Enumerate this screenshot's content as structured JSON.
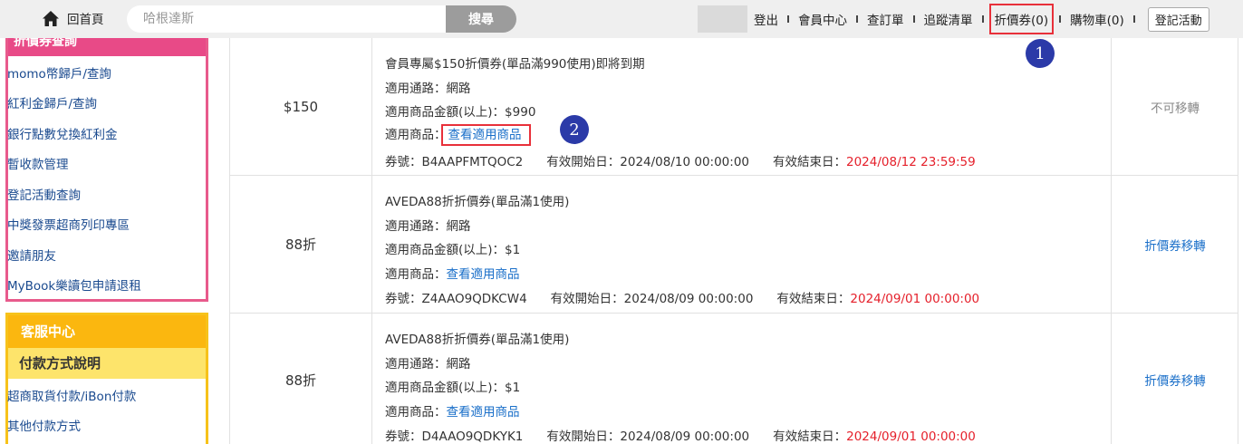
{
  "header": {
    "home_label": "回首頁",
    "search_placeholder": "哈根達斯",
    "search_button": "搜尋",
    "nav": {
      "logout": "登出",
      "member_center": "會員中心",
      "orders": "查訂單",
      "wishlist": "追蹤清單",
      "coupons": "折價券(0)",
      "cart": "購物車(0)",
      "event_register": "登記活動"
    }
  },
  "annotations": {
    "marker_1": "1",
    "marker_2": "2"
  },
  "sidebar": {
    "member_section": {
      "header": "折價券查詢",
      "items": [
        "momo幣歸戶/查詢",
        "紅利金歸戶/查詢",
        "銀行點數兌換紅利金",
        "暫收款管理",
        "登記活動查詢",
        "中獎發票超商列印專區",
        "邀請朋友",
        "MyBook樂讀包申請退租"
      ]
    },
    "service_section": {
      "header": "客服中心",
      "subheader": "付款方式說明",
      "items": [
        "超商取貨付款/iBon付款",
        "其他付款方式"
      ]
    }
  },
  "coupons": [
    {
      "amount": "$150",
      "title": "會員專屬$150折價券(單品滿990使用)即將到期",
      "channel_label": "適用通路：",
      "channel": "網路",
      "min_label": "適用商品金額(以上)：",
      "min_amount": "$990",
      "goods_label": "適用商品：",
      "goods_link": "查看適用商品",
      "code_label": "券號：",
      "code": "B4AAPFMTQOC2",
      "start_label": "有效開始日：",
      "start": "2024/08/10 00:00:00",
      "end_label": "有效結束日：",
      "end": "2024/08/12 23:59:59",
      "action": "不可移轉"
    },
    {
      "amount": "88折",
      "title": "AVEDA88折折價券(單品滿1使用)",
      "channel_label": "適用通路：",
      "channel": "網路",
      "min_label": "適用商品金額(以上)：",
      "min_amount": "$1",
      "goods_label": "適用商品：",
      "goods_link": "查看適用商品",
      "code_label": "券號：",
      "code": "Z4AAO9QDKCW4",
      "start_label": "有效開始日：",
      "start": "2024/08/09 00:00:00",
      "end_label": "有效結束日：",
      "end": "2024/09/01 00:00:00",
      "action": "折價券移轉"
    },
    {
      "amount": "88折",
      "title": "AVEDA88折折價券(單品滿1使用)",
      "channel_label": "適用通路：",
      "channel": "網路",
      "min_label": "適用商品金額(以上)：",
      "min_amount": "$1",
      "goods_label": "適用商品：",
      "goods_link": "查看適用商品",
      "code_label": "券號：",
      "code": "D4AAO9QDKYK1",
      "start_label": "有效開始日：",
      "start": "2024/08/09 00:00:00",
      "end_label": "有效結束日：",
      "end": "2024/09/01 00:00:00",
      "action": "折價券移轉"
    }
  ],
  "colors": {
    "pink_accent": "#e84a87",
    "orange_accent": "#fbb70f",
    "yellow_sub": "#fde46b",
    "link_blue": "#1a6fc9",
    "expiry_red": "#e5202b",
    "marker_blue": "#2b3aa8",
    "highlight_red": "#e8303a"
  },
  "icons": {
    "home": "home-icon"
  }
}
